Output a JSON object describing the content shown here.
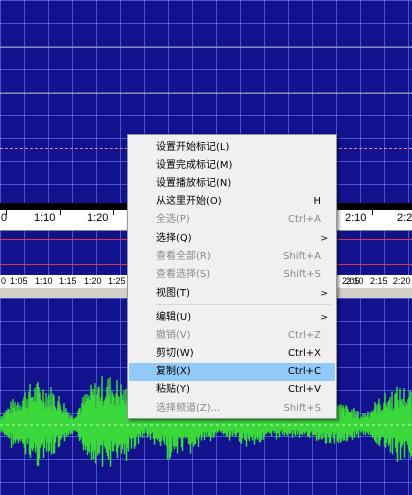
{
  "timeline_upper": [
    "0",
    "1:10",
    "1:20",
    "2:10",
    "2:2"
  ],
  "timeline_lower": [
    "0",
    "1:05",
    "1:10",
    "1:15",
    "1:20",
    "1:25",
    "2:05",
    "2:10",
    "2:15",
    "2:20",
    "2:2"
  ],
  "context_menu": {
    "items": [
      {
        "label": "设置开始标记(L)",
        "shortcut": "",
        "disabled": false,
        "submenu": false
      },
      {
        "label": "设置完成标记(M)",
        "shortcut": "",
        "disabled": false,
        "submenu": false
      },
      {
        "label": "设置播放标记(N)",
        "shortcut": "",
        "disabled": false,
        "submenu": false
      },
      {
        "label": "从这里开始(O)",
        "shortcut": "H",
        "disabled": false,
        "submenu": false
      },
      {
        "label": "全选(P)",
        "shortcut": "Ctrl+A",
        "disabled": true,
        "submenu": false
      },
      {
        "label": "选择(Q)",
        "shortcut": "",
        "disabled": false,
        "submenu": true
      },
      {
        "label": "查看全部(R)",
        "shortcut": "Shift+A",
        "disabled": true,
        "submenu": false
      },
      {
        "label": "查看选择(S)",
        "shortcut": "Shift+S",
        "disabled": true,
        "submenu": false
      },
      {
        "label": "视图(T)",
        "shortcut": "",
        "disabled": false,
        "submenu": true
      },
      {
        "label": "编辑(U)",
        "shortcut": "",
        "disabled": false,
        "submenu": true
      },
      {
        "label": "撤销(V)",
        "shortcut": "Ctrl+Z",
        "disabled": true,
        "submenu": false
      },
      {
        "label": "剪切(W)",
        "shortcut": "Ctrl+X",
        "disabled": false,
        "submenu": false
      },
      {
        "label": "复制(X)",
        "shortcut": "Ctrl+C",
        "disabled": false,
        "submenu": false,
        "highlighted": true
      },
      {
        "label": "粘贴(Y)",
        "shortcut": "Ctrl+V",
        "disabled": false,
        "submenu": false
      },
      {
        "label": "选择频道(Z)...",
        "shortcut": "Shift+S",
        "disabled": true,
        "submenu": false
      }
    ],
    "submenu_arrow": ">"
  },
  "colors": {
    "panel_bg": "#12128f",
    "waveform": "#3bd83b",
    "highlight": "#91c9f7",
    "disabled_text": "#8a8a8a"
  }
}
